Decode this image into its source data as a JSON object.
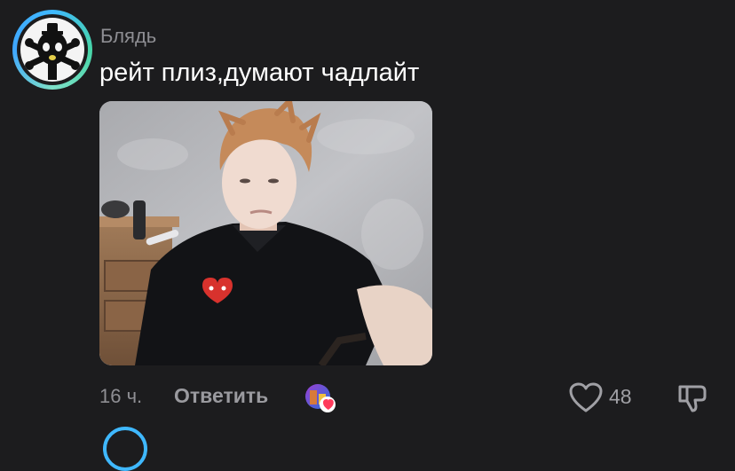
{
  "comment": {
    "username": "Блядь",
    "text": "рейт плиз,думают чадлайт",
    "time": "16 ч.",
    "reply_label": "Ответить",
    "likes": "48"
  },
  "icons": {
    "avatar": "skull-mask-avatar",
    "reactor": "reactor-avatar-with-heart",
    "like": "heart-outline-icon",
    "dislike": "thumb-down-icon"
  },
  "colors": {
    "background": "#1c1c1e",
    "secondary_text": "#8e8e93",
    "avatar_ring": "#3fb8ff",
    "heart_badge": "#ff3b5c"
  }
}
